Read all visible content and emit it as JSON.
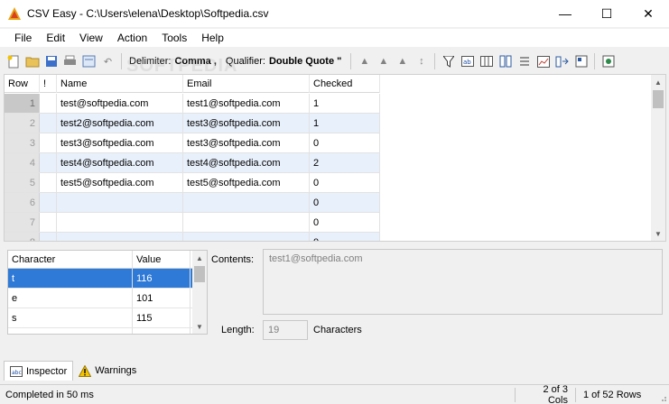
{
  "window": {
    "title": "CSV Easy - C:\\Users\\elena\\Desktop\\Softpedia.csv",
    "minimize": "—",
    "maximize": "☐",
    "close": "✕"
  },
  "menu": [
    "File",
    "Edit",
    "View",
    "Action",
    "Tools",
    "Help"
  ],
  "toolbar": {
    "delimiter_label": "Delimiter:",
    "delimiter_value": "Comma ,",
    "qualifier_label": "Qualifier:",
    "qualifier_value": "Double Quote \""
  },
  "watermark": "SOFTPEDIA",
  "grid": {
    "headers": [
      "Row",
      "!",
      "Name",
      "Email",
      "Checked"
    ],
    "rows": [
      {
        "num": "1",
        "name": "test@softpedia.com",
        "email": "test1@softpedia.com",
        "checked": "1"
      },
      {
        "num": "2",
        "name": "test2@softpedia.com",
        "email": "test3@softpedia.com",
        "checked": "1"
      },
      {
        "num": "3",
        "name": "test3@softpedia.com",
        "email": "test3@softpedia.com",
        "checked": "0"
      },
      {
        "num": "4",
        "name": "test4@softpedia.com",
        "email": "test4@softpedia.com",
        "checked": "2"
      },
      {
        "num": "5",
        "name": "test5@softpedia.com",
        "email": "test5@softpedia.com",
        "checked": "0"
      },
      {
        "num": "6",
        "name": "",
        "email": "",
        "checked": "0"
      },
      {
        "num": "7",
        "name": "",
        "email": "",
        "checked": "0"
      },
      {
        "num": "8",
        "name": "",
        "email": "",
        "checked": "0"
      }
    ]
  },
  "inspector": {
    "headers": [
      "Character",
      "Value"
    ],
    "rows": [
      {
        "char": "t",
        "value": "116"
      },
      {
        "char": "e",
        "value": "101"
      },
      {
        "char": "s",
        "value": "115"
      },
      {
        "char": "t",
        "value": "116"
      }
    ],
    "contents_label": "Contents:",
    "contents_value": "test1@softpedia.com",
    "length_label": "Length:",
    "length_value": "19",
    "length_unit": "Characters"
  },
  "tabs": [
    "Inspector",
    "Warnings"
  ],
  "status": {
    "message": "Completed in 50 ms",
    "cols": "2 of 3 Cols",
    "rows": "1 of 52 Rows"
  },
  "colors": {
    "selection": "#2f7ad7",
    "alt_row": "#e8f0fb",
    "accent_icon": "#e8a317"
  }
}
